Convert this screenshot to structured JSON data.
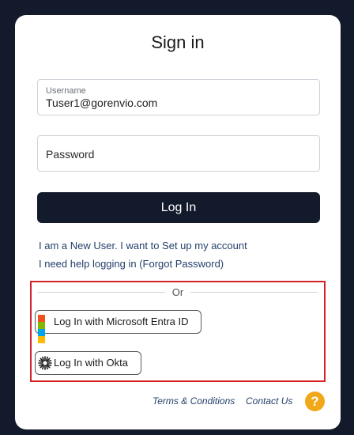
{
  "title": "Sign in",
  "username": {
    "label": "Username",
    "value": "Tuser1@gorenvio.com"
  },
  "password": {
    "placeholder": "Password"
  },
  "login_button": "Log In",
  "links": {
    "new_user": "I am a New User. I want to Set up my account",
    "forgot": "I need help logging in (Forgot Password)"
  },
  "sso": {
    "divider": "Or",
    "microsoft": "Log In with Microsoft Entra ID",
    "okta": "Log In with Okta"
  },
  "footer": {
    "terms": "Terms & Conditions",
    "contact": "Contact Us",
    "help": "?"
  },
  "colors": {
    "background": "#131a2b",
    "button": "#131a2b",
    "link": "#24406b",
    "highlight_border": "#d32127",
    "help_icon": "#f0a818",
    "ms_red": "#f25022",
    "ms_green": "#7fba00",
    "ms_blue": "#00a4ef",
    "ms_yellow": "#ffb900"
  }
}
